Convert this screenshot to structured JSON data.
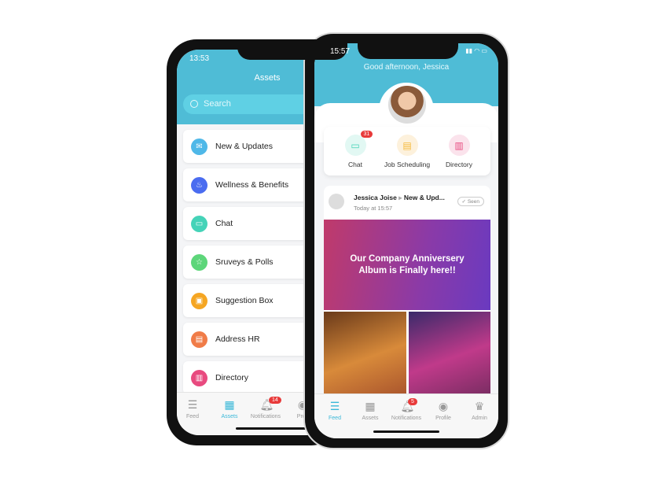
{
  "back_phone": {
    "time": "13:53",
    "title": "Assets",
    "search_placeholder": "Search",
    "items": [
      {
        "label": "New & Updates",
        "icon": "envelope-icon",
        "color": "#4fb8e8"
      },
      {
        "label": "Wellness & Benefits",
        "icon": "wellness-icon",
        "color": "#4a6cf0"
      },
      {
        "label": "Chat",
        "icon": "chat-icon",
        "color": "#45d3b8"
      },
      {
        "label": "Sruveys & Polls",
        "icon": "star-icon",
        "color": "#5dd67a"
      },
      {
        "label": "Suggestion Box",
        "icon": "suggestion-box-icon",
        "color": "#f5a623"
      },
      {
        "label": "Address HR",
        "icon": "document-icon",
        "color": "#f07c48"
      },
      {
        "label": "Directory",
        "icon": "directory-icon",
        "color": "#e84a7f"
      }
    ],
    "tabs": [
      {
        "label": "Feed"
      },
      {
        "label": "Assets",
        "active": true
      },
      {
        "label": "Notifications",
        "badge": "14"
      },
      {
        "label": "Profi"
      }
    ]
  },
  "front_phone": {
    "time": "15:57",
    "greeting": "Good afternoon, Jessica",
    "quick_actions": [
      {
        "label": "Chat",
        "badge": "31",
        "color": "#45d3b8"
      },
      {
        "label": "Job Scheduling",
        "color": "#f5b93a"
      },
      {
        "label": "Directory",
        "color": "#e84a7f"
      }
    ],
    "post": {
      "author": "Jessica Joise",
      "channel": "New & Upd...",
      "time": "Today at 15:57",
      "status": "Seen",
      "banner_text": "Our Company Anniversery Album is Finally here!!"
    },
    "tabs": [
      {
        "label": "Feed",
        "active": true
      },
      {
        "label": "Assets"
      },
      {
        "label": "Notifications",
        "badge": "5"
      },
      {
        "label": "Profile"
      },
      {
        "label": "Admin"
      }
    ]
  },
  "accent": "#4fbcd6"
}
